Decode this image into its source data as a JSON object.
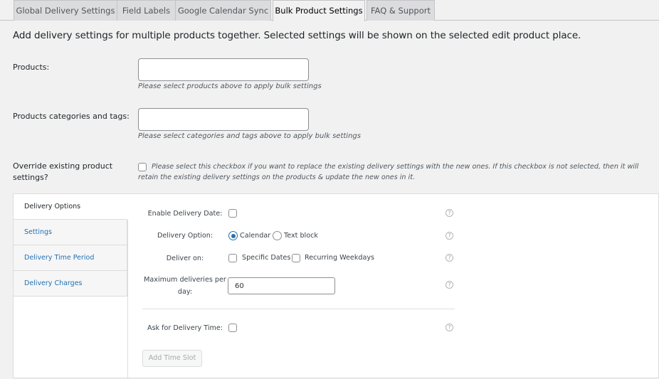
{
  "tabs": [
    {
      "label": "Global Delivery Settings",
      "active": false
    },
    {
      "label": "Field Labels",
      "active": false
    },
    {
      "label": "Google Calendar Sync",
      "active": false
    },
    {
      "label": "Bulk Product Settings",
      "active": true
    },
    {
      "label": "FAQ & Support",
      "active": false
    }
  ],
  "intro": "Add delivery settings for multiple products together. Selected settings will be shown on the selected edit product place.",
  "products": {
    "label": "Products:",
    "value": "",
    "description": "Please select products above to apply bulk settings"
  },
  "categories": {
    "label": "Products categories and tags:",
    "value": "",
    "description": "Please select categories and tags above to apply bulk settings"
  },
  "override": {
    "label": "Override existing product settings?",
    "checked": false,
    "description": "Please select this checkbox if you want to replace the existing delivery settings with the new ones. If this checkbox is not selected, then it will retain the existing delivery settings on the products & update the new ones in it."
  },
  "side_tabs": [
    {
      "label": "Delivery Options",
      "active": true
    },
    {
      "label": "Settings",
      "active": false
    },
    {
      "label": "Delivery Time Period",
      "active": false
    },
    {
      "label": "Delivery Charges",
      "active": false
    }
  ],
  "fields": {
    "enable_delivery_date": {
      "label": "Enable Delivery Date:",
      "checked": false
    },
    "delivery_option": {
      "label": "Delivery Option:",
      "options": [
        "Calendar",
        "Text block"
      ],
      "selected": "Calendar"
    },
    "deliver_on": {
      "label": "Deliver on:",
      "options": [
        {
          "label": "Specific Dates",
          "checked": false
        },
        {
          "label": "Recurring Weekdays",
          "checked": false
        }
      ]
    },
    "max_deliveries": {
      "label": "Maximum deliveries per day:",
      "value": "60"
    },
    "ask_delivery_time": {
      "label": "Ask for Delivery Time:",
      "checked": false
    }
  },
  "add_time_slot_label": "Add Time Slot",
  "help_icon_glyph": "?",
  "colors": {
    "accent": "#2271b1",
    "background": "#f1f1f1",
    "link": "#2271b1"
  }
}
